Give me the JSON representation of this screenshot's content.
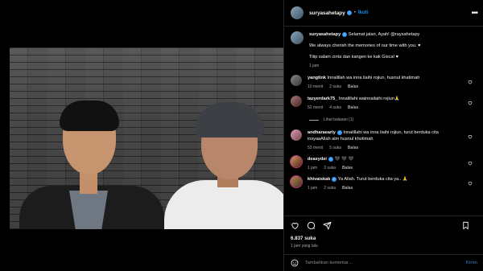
{
  "post": {
    "username": "suryasahetapy",
    "follow_label": "Ikuti",
    "caption": {
      "line1_lead": "Selamat jalan, Ayah! @raysahetapy",
      "line2": "We always cherish the memories of our time with you. ♥",
      "line3": "Titip salam cinta dan kangen ke kak Gisca! ♥",
      "time": "1 jam"
    },
    "likes": "6.837 suka",
    "time_ago": "1 jam yang lalu",
    "add_comment_placeholder": "Tambahkan komentar…",
    "post_label": "Kirim"
  },
  "comments": [
    {
      "user": "yangtink",
      "text": "Innalillah wa inna ilaihi rojiun, husnul khatimah",
      "time": "10 menit",
      "likes": "2 suka",
      "reply": "Balas",
      "verified": false
    },
    {
      "user": "tazyerdark75_",
      "text": "Innalillahi wainnailaihi rojiun🙏",
      "time": "52 menit",
      "likes": "4 suka",
      "reply": "Balas",
      "verified": false
    },
    {
      "user": "andharaearly",
      "text": "Innalillahi wa inna ilaihi rojiun, turut berduka cita insyaaAllah alm husnul khotimah",
      "time": "53 menit",
      "likes": "5 suka",
      "reply": "Balas",
      "verified": true
    },
    {
      "user": "deasydei",
      "text": "🖤 🖤 🖤",
      "time": "1 jam",
      "likes": "3 suka",
      "reply": "Balas",
      "verified": true
    },
    {
      "user": "khivaiskak",
      "text": "Ya Allah. Turut berduka cita ya.. 🙏",
      "time": "1 jam",
      "likes": "2 suka",
      "reply": "Balas",
      "verified": true
    }
  ],
  "view_replies": "Lihat balasan (1)",
  "colors": {
    "accent": "#0095f6",
    "verified": "#3897f0",
    "bg": "#000000"
  },
  "icons": [
    "heart-icon",
    "comment-icon",
    "share-icon",
    "bookmark-icon",
    "emoji-icon",
    "more-icon"
  ]
}
